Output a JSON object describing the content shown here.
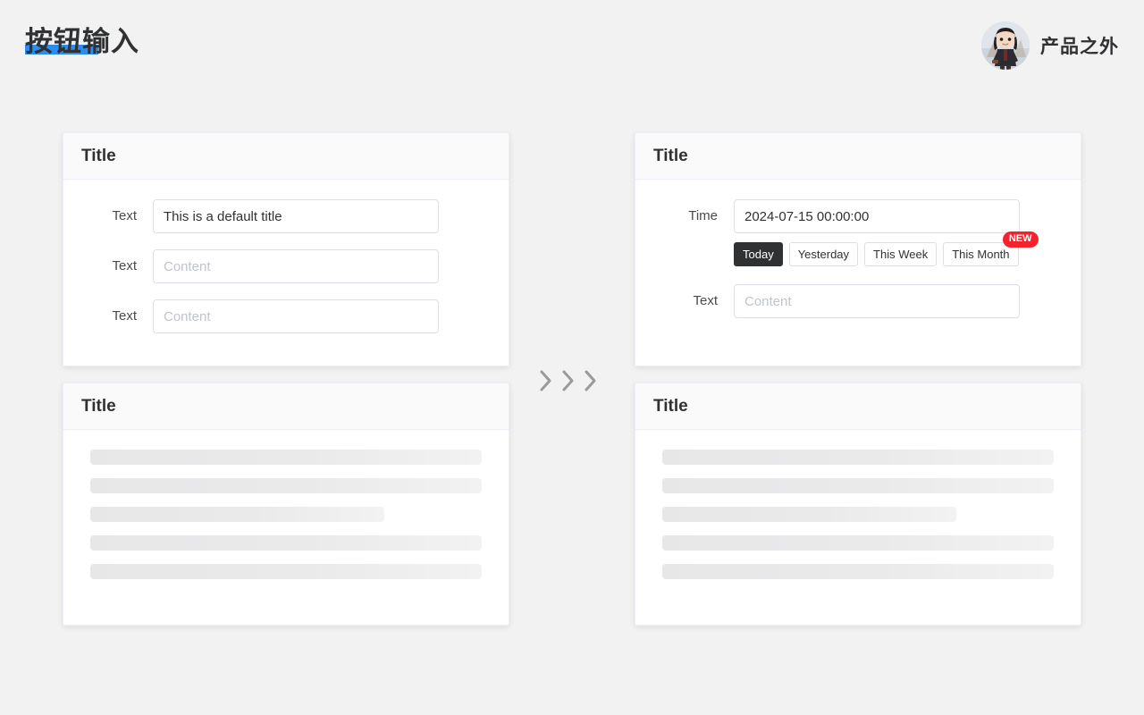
{
  "header": {
    "title": "按钮输入",
    "underline_color": "#2d8cf0",
    "brand_name": "产品之外",
    "avatar_icon": "user-avatar-icon"
  },
  "cards": {
    "form_left": {
      "title": "Title",
      "rows": [
        {
          "label": "Text",
          "value": "This is a default title",
          "placeholder": ""
        },
        {
          "label": "Text",
          "value": "",
          "placeholder": "Content"
        },
        {
          "label": "Text",
          "value": "",
          "placeholder": "Content"
        }
      ]
    },
    "form_right": {
      "title": "Title",
      "time_label": "Time",
      "time_value": "2024-07-15 00:00:00",
      "quick_buttons": [
        {
          "label": "Today",
          "active": true,
          "badge": ""
        },
        {
          "label": "Yesterday",
          "active": false,
          "badge": ""
        },
        {
          "label": "This Week",
          "active": false,
          "badge": ""
        },
        {
          "label": "This Month",
          "active": false,
          "badge": "NEW"
        }
      ],
      "badge_text": "NEW",
      "badge_color": "#f5222d",
      "text_label": "Text",
      "text_value": "",
      "text_placeholder": "Content"
    },
    "skeleton_left": {
      "title": "Title",
      "lines": [
        100,
        100,
        75,
        100,
        100
      ]
    },
    "skeleton_right": {
      "title": "Title",
      "lines": [
        100,
        100,
        75,
        100,
        100
      ]
    }
  },
  "arrows": {
    "icon": "chevron-right-icon",
    "count": 3,
    "color": "#9a9a9a"
  },
  "colors": {
    "page_background": "#f2f2f2",
    "card_background": "#ffffff",
    "card_header_background": "#fafafa",
    "accent": "#2d8cf0",
    "active_button": "#303133",
    "border": "#dcdfe6",
    "placeholder": "#c0c4cc"
  }
}
